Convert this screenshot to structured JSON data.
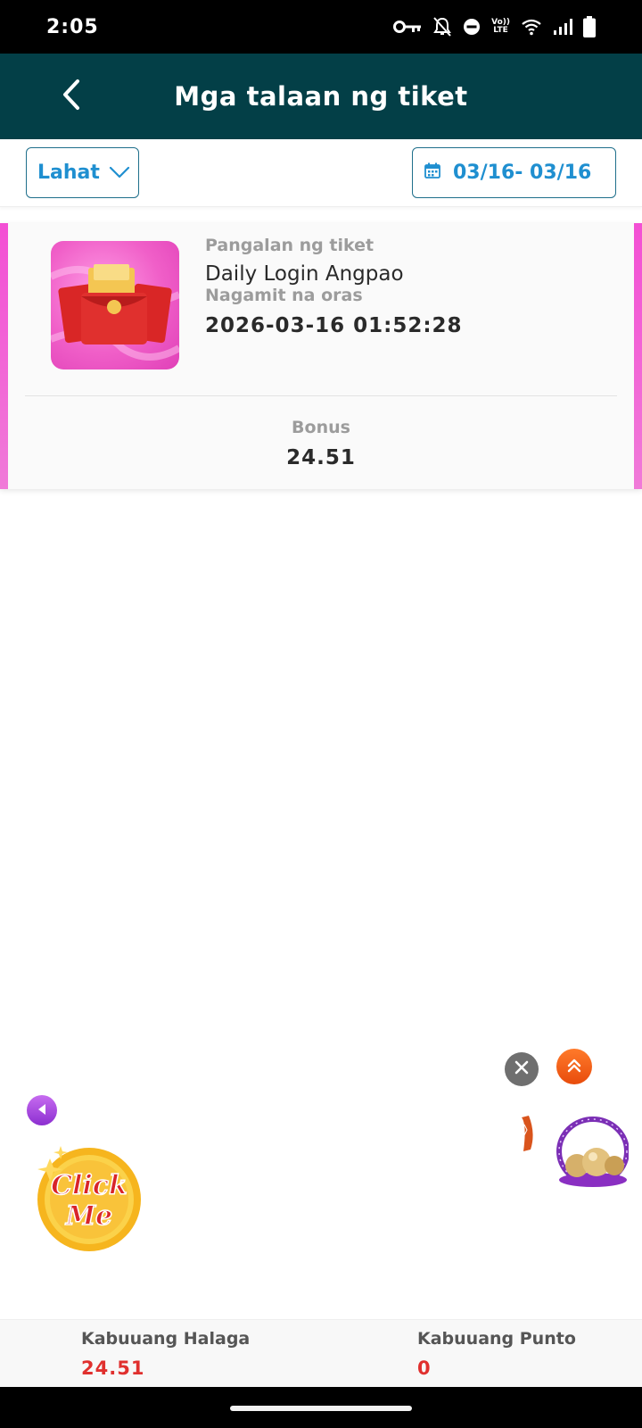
{
  "status_bar": {
    "time": "2:05",
    "lte_top": "Vo))",
    "lte_bottom": "LTE"
  },
  "header": {
    "title": "Mga talaan ng tiket"
  },
  "filters": {
    "type_selected": "Lahat",
    "date_range": "03/16- 03/16"
  },
  "ticket": {
    "name_label": "Pangalan ng tiket",
    "name": "Daily Login Angpao",
    "time_label": "Nagamit na oras",
    "time": "2026-03-16 01:52:28",
    "bonus_label": "Bonus",
    "bonus": "24.51"
  },
  "widgets": {
    "click_me_line1": "Click",
    "click_me_line2": "Me"
  },
  "summary": {
    "total_amount_label": "Kabuuang Halaga",
    "total_amount": "24.51",
    "total_points_label": "Kabuuang Punto",
    "total_points": "0"
  },
  "colors": {
    "header_bg": "#033f47",
    "accent_blue": "#1f8fd0",
    "accent_pink": "#f34fd4",
    "total_red": "#e0302e"
  }
}
